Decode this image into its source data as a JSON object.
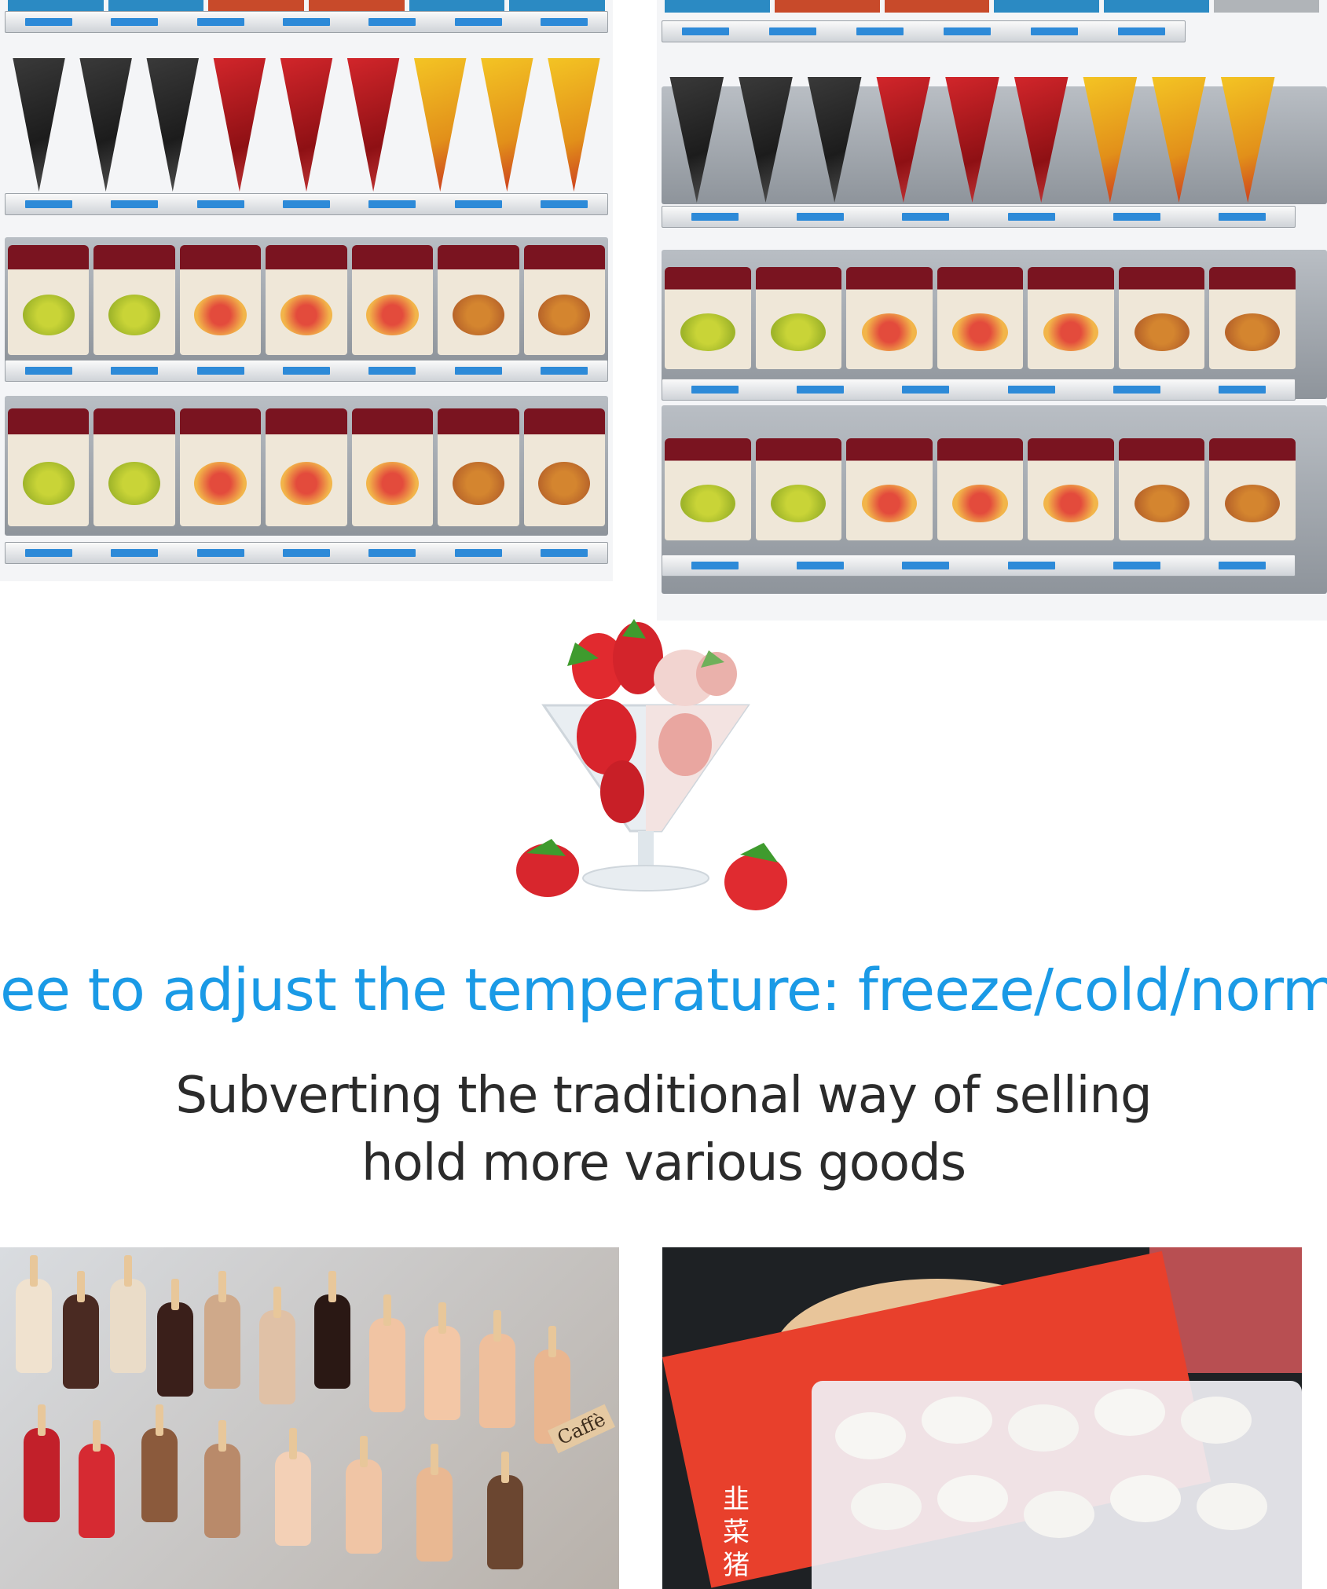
{
  "headline": "ee to adjust the temperature: freeze/cold/norm",
  "subheading": {
    "line1": "Subverting the traditional way of selling",
    "line2": "hold more various goods"
  },
  "shelf_images": [
    {
      "name": "front-view",
      "rows": [
        "cones",
        "cups-single",
        "cups-double"
      ]
    },
    {
      "name": "angled-view",
      "rows": [
        "cones",
        "cups-single",
        "cups-double"
      ]
    }
  ],
  "dessert_image": {
    "name": "strawberry-sundae"
  },
  "bottom_images": [
    {
      "name": "ice-cream-bars",
      "labels": [
        "Caffè"
      ]
    },
    {
      "name": "frozen-dumplings",
      "labels": [
        "韭",
        "菜",
        "猪"
      ]
    }
  ],
  "colors": {
    "headline": "#1a9ae6",
    "subheading": "#2b2b2b",
    "tag": "#2d8ad8"
  }
}
